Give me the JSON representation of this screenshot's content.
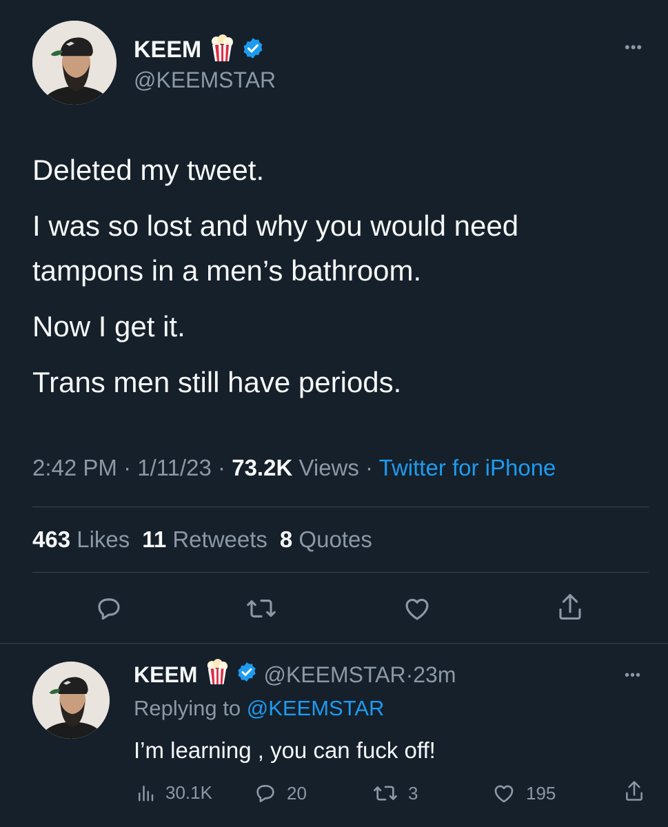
{
  "tweet": {
    "author": {
      "name": "KEEM",
      "emoji": "🍿",
      "handle": "@KEEMSTAR"
    },
    "more_label": "•••",
    "lines": [
      "Deleted my tweet.",
      "I was so lost and why you would need",
      "tampons in a men’s bathroom.",
      "Now I get it.",
      "Trans men still have periods."
    ],
    "meta": {
      "time": "2:42 PM",
      "sep1": " · ",
      "date": "1/11/23",
      "sep2": " · ",
      "views_count": "73.2K",
      "views_label": " Views",
      "sep3": " · ",
      "source": "Twitter for iPhone"
    },
    "stats": {
      "likes_count": "463",
      "likes_label": " Likes",
      "retweets_count": "11",
      "retweets_label": " Retweets",
      "quotes_count": "8",
      "quotes_label": " Quotes"
    },
    "actions": [
      "reply-icon",
      "retweet-icon",
      "like-icon",
      "share-icon"
    ]
  },
  "reply": {
    "author": {
      "name": "KEEM",
      "emoji": "🍿",
      "handle": "@KEEMSTAR",
      "separator": " · ",
      "time": "23m"
    },
    "replying_prefix": "Replying to ",
    "replying_handle": "@KEEMSTAR",
    "text": "I’m learning , you can fuck off!",
    "more_label": "•••",
    "stats": {
      "views": "30.1K",
      "replies": "20",
      "retweets": "3",
      "likes": "195"
    }
  },
  "colors": {
    "background": "#15202b",
    "text": "#f7f9f9",
    "secondary": "#8b98a5",
    "accent": "#1d9bf0",
    "divider": "#38444d"
  }
}
